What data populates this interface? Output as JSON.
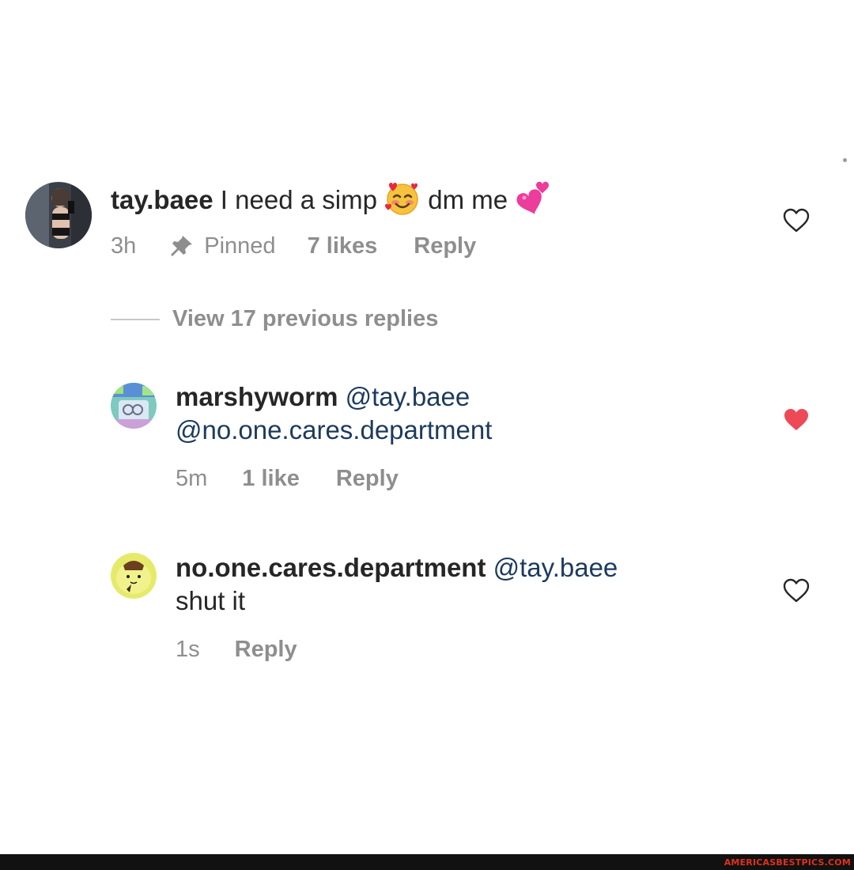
{
  "comments": [
    {
      "username": "tay.baee",
      "text_before_emoji": " I need a simp ",
      "text_after_emoji": " dm me ",
      "time": "3h",
      "pinned_label": "Pinned",
      "likes_label": "7 likes",
      "reply_label": "Reply",
      "liked": false,
      "avatar_icon": "user-photo-avatar",
      "emoji_1": "smiling-face-with-hearts-emoji",
      "emoji_2": "two-hearts-emoji"
    },
    {
      "username": "marshyworm",
      "mention_1": "@tay.baee",
      "mention_2": "@no.one.cares.department",
      "time": "5m",
      "likes_label": "1 like",
      "reply_label": "Reply",
      "liked": true,
      "avatar_icon": "cartoon-avatar"
    },
    {
      "username": "no.one.cares.department",
      "mention_1": "@tay.baee",
      "text": "shut it",
      "time": "1s",
      "reply_label": "Reply",
      "liked": false,
      "avatar_icon": "yellow-cartoon-avatar"
    }
  ],
  "view_replies_label": "View 17 previous replies",
  "watermark": "AMERICASBESTPICS.COM",
  "colors": {
    "text": "#262626",
    "meta": "#8e8e8e",
    "mention": "#1c3a5e",
    "liked_heart": "#ed4956",
    "watermark": "#e0311b"
  }
}
